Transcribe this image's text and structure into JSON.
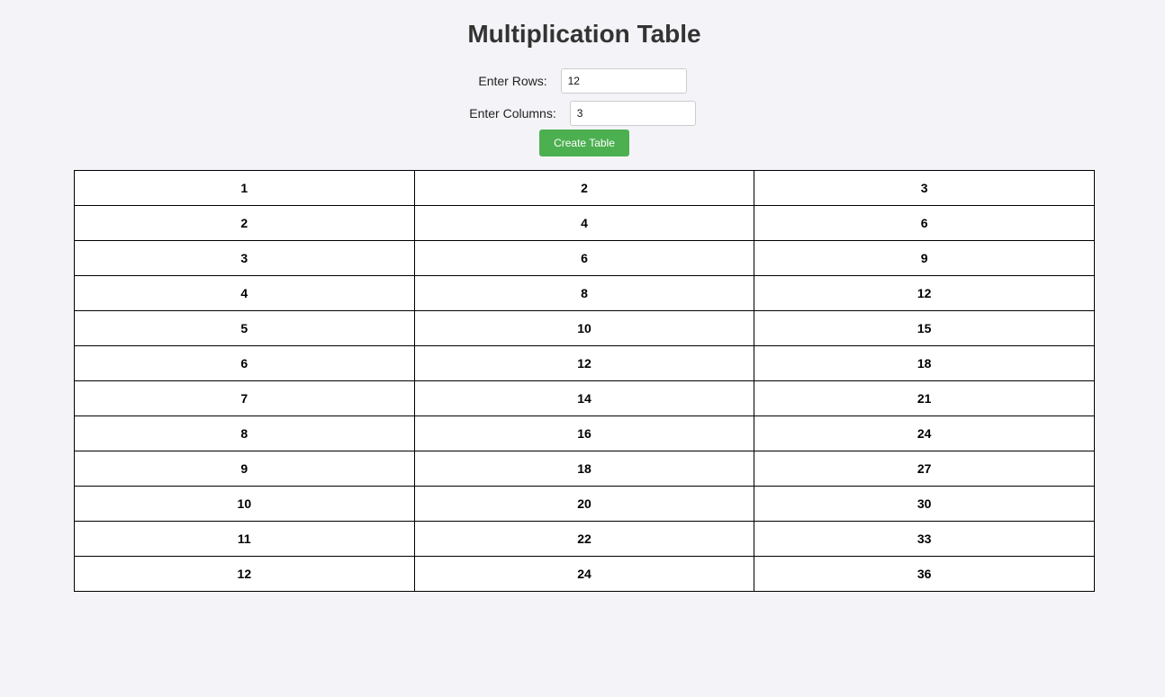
{
  "title": "Multiplication Table",
  "form": {
    "rows_label": "Enter Rows:",
    "rows_value": "12",
    "cols_label": "Enter Columns:",
    "cols_value": "3",
    "button_label": "Create Table"
  },
  "colors": {
    "background": "#f4f4f8",
    "button": "#4caf50",
    "button_text": "#ffffff",
    "table_border": "#000000"
  },
  "table": {
    "rows": [
      [
        "1",
        "2",
        "3"
      ],
      [
        "2",
        "4",
        "6"
      ],
      [
        "3",
        "6",
        "9"
      ],
      [
        "4",
        "8",
        "12"
      ],
      [
        "5",
        "10",
        "15"
      ],
      [
        "6",
        "12",
        "18"
      ],
      [
        "7",
        "14",
        "21"
      ],
      [
        "8",
        "16",
        "24"
      ],
      [
        "9",
        "18",
        "27"
      ],
      [
        "10",
        "20",
        "30"
      ],
      [
        "11",
        "22",
        "33"
      ],
      [
        "12",
        "24",
        "36"
      ]
    ]
  }
}
